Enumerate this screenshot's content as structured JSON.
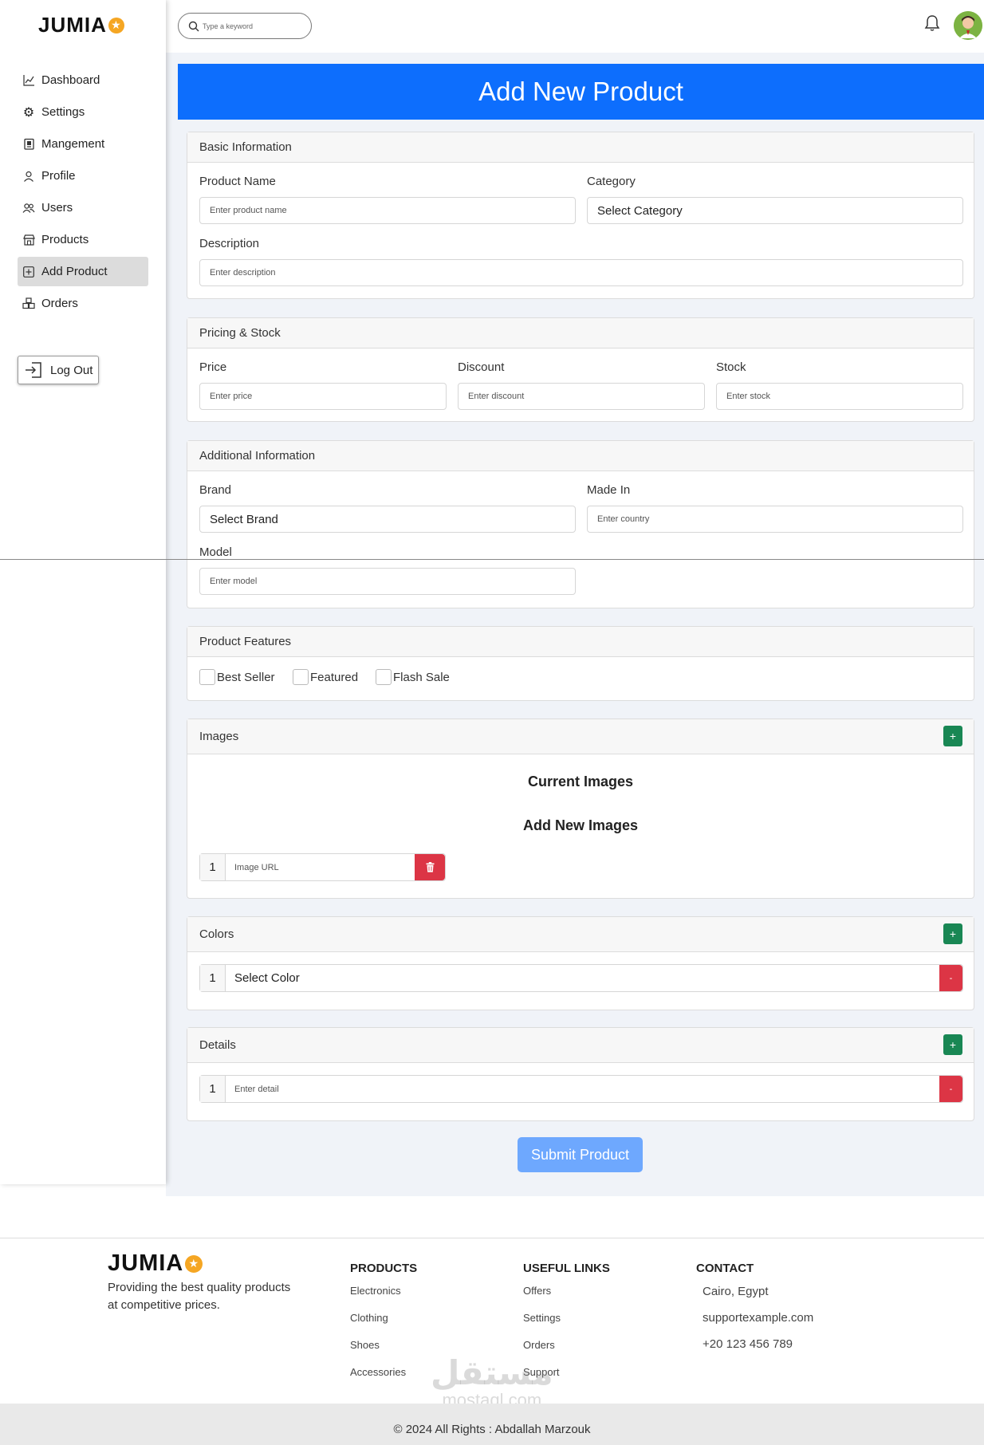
{
  "brand": {
    "name": "JUMIA",
    "star_color": "#f5a623"
  },
  "search": {
    "placeholder": "Type a keyword"
  },
  "sidebar": {
    "items": [
      {
        "label": "Dashboard",
        "icon": "chart-line-icon"
      },
      {
        "label": "Settings",
        "icon": "gear-icon"
      },
      {
        "label": "Mangement",
        "icon": "clipboard-icon"
      },
      {
        "label": "Profile",
        "icon": "person-icon"
      },
      {
        "label": "Users",
        "icon": "users-icon"
      },
      {
        "label": "Products",
        "icon": "store-icon"
      },
      {
        "label": "Add Product",
        "icon": "plus-square-icon",
        "active": true
      },
      {
        "label": "Orders",
        "icon": "boxes-icon"
      }
    ],
    "logout_label": "Log Out"
  },
  "page_title": "Add New Product",
  "basic": {
    "title": "Basic Information",
    "product_name_label": "Product Name",
    "product_name_placeholder": "Enter product name",
    "category_label": "Category",
    "category_value": "Select Category",
    "description_label": "Description",
    "description_placeholder": "Enter description"
  },
  "pricing": {
    "title": "Pricing & Stock",
    "price_label": "Price",
    "price_placeholder": "Enter price",
    "discount_label": "Discount",
    "discount_placeholder": "Enter discount",
    "stock_label": "Stock",
    "stock_placeholder": "Enter stock"
  },
  "additional": {
    "title": "Additional Information",
    "brand_label": "Brand",
    "brand_value": "Select Brand",
    "made_in_label": "Made In",
    "made_in_placeholder": "Enter country",
    "model_label": "Model",
    "model_placeholder": "Enter model"
  },
  "features": {
    "title": "Product Features",
    "options": [
      "Best Seller",
      "Featured",
      "Flash Sale"
    ]
  },
  "images": {
    "title": "Images",
    "add_label": "+",
    "current_heading": "Current Images",
    "new_heading": "Add New Images",
    "row_number": "1",
    "url_placeholder": "Image URL"
  },
  "colors": {
    "title": "Colors",
    "add_label": "+",
    "row_number": "1",
    "value": "Select Color",
    "remove_label": "-"
  },
  "details": {
    "title": "Details",
    "add_label": "+",
    "row_number": "1",
    "placeholder": "Enter detail",
    "remove_label": "-"
  },
  "submit_label": "Submit Product",
  "footer": {
    "tagline": "Providing the best quality products at competitive prices.",
    "products_heading": "PRODUCTS",
    "products_links": [
      "Electronics",
      "Clothing",
      "Shoes",
      "Accessories"
    ],
    "useful_heading": "USEFUL LINKS",
    "useful_links": [
      "Offers",
      "Settings",
      "Orders",
      "Support"
    ],
    "contact_heading": "CONTACT",
    "contact_items": [
      "Cairo, Egypt",
      "supportexample.com",
      "+20 123 456 789"
    ],
    "copyright": "© 2024 All Rights : Abdallah Marzouk"
  },
  "watermark": {
    "arabic": "مستقل",
    "latin": "mostaql.com"
  },
  "colors_theme": {
    "primary": "#0d6efd",
    "success": "#198754",
    "danger": "#dc3545",
    "submit": "#6ea8fe"
  }
}
